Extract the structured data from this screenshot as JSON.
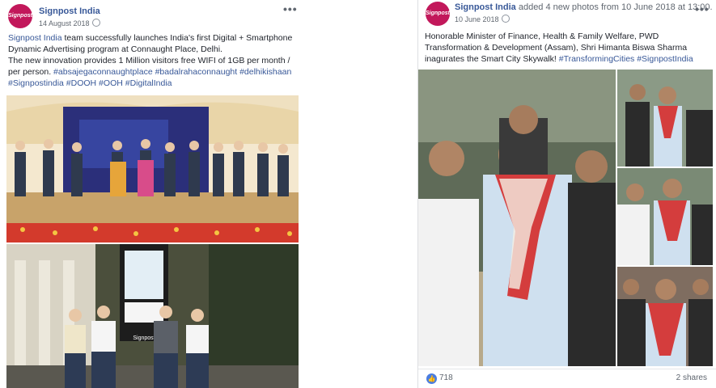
{
  "post1": {
    "avatar_text": "Signpost",
    "page_name": "Signpost India",
    "date": "14 August 2018",
    "more": "•••",
    "text": {
      "link_name": "Signpost India",
      "line1_rest": " team successfully launches India's first Digital + Smartphone",
      "line2": "Dynamic Advertising program at Connaught Place, Delhi.",
      "line3": "The new innovation provides 1 Million visitors free WIFI of 1GB per month /",
      "line4": "per person. ",
      "tags_a": "#absajegaconnaughtplace #badalrahaconnaught #delhikishaan",
      "tags_b": "#Signpostindia #DOOH #OOH #DigitalIndia"
    },
    "photo_kiosk_brand": "Signpost"
  },
  "post2": {
    "avatar_text": "Signpost",
    "page_name": "Signpost India",
    "activity": " added 4 new photos from 10 June 2018 at 13:00.",
    "date": "10 June 2018",
    "more": "•••",
    "text": {
      "line1": "Honorable Minister of Finance, Health & Family Welfare, PWD",
      "line2": "Transformation & Development (Assam), Shri Himanta Biswa Sharma",
      "line3_plain": "inagurates the Smart City Skywalk! ",
      "tags": "#TransformingCities #SignpostIndia"
    },
    "likes": "718",
    "shares": "2 shares",
    "like_icon": "thumbs-up-icon"
  },
  "colors": {
    "link": "#385898",
    "brand": "#c2185b",
    "stage": "#f4e8cf",
    "flowers": "#d33a2c"
  }
}
